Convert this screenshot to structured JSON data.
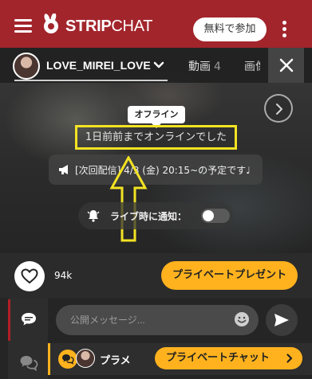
{
  "header": {
    "brand": "STRIPCHAT",
    "brand_bold": "STRIP",
    "brand_light": "CHAT",
    "join_label": "無料で参加",
    "colors": {
      "brand_red": "#a2252c",
      "accent_yellow": "#ffb21e"
    }
  },
  "stream_bar": {
    "model_name": "LOVE_MIREI_LOVE",
    "tab_videos_label": "動画",
    "tab_videos_count": "4",
    "tab_photos_label": "画像"
  },
  "offline": {
    "badge": "オフライン",
    "last_online": "1日前前までオンラインでした",
    "schedule": "[次回配信] 4/3 (金) 20:15~の予定です♩",
    "notify_label": "ライブ時に通知：",
    "notify_enabled": false
  },
  "actions": {
    "favorites_count": "94k",
    "private_gift_label": "プライベートプレゼント"
  },
  "chat": {
    "input_placeholder": "公開メッセージ...",
    "ticker_name": "プラメ",
    "private_chat_label": "プライベートチャット"
  }
}
